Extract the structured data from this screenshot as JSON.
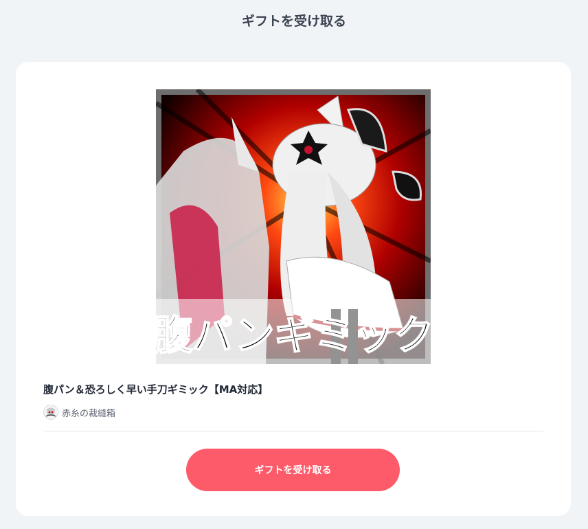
{
  "header": {
    "title": "ギフトを受け取る"
  },
  "product": {
    "image_caption": "腹パンギミック",
    "title": "腹パン＆恐ろしく早い手刀ギミック【MA対応】",
    "shop_name": "赤糸の裁縫箱"
  },
  "actions": {
    "receive_label": "ギフトを受け取る"
  },
  "colors": {
    "accent": "#fd5b6a",
    "background": "#f1f4f7",
    "card": "#ffffff"
  },
  "icons": {
    "shop_avatar": "shop-avatar-icon"
  }
}
